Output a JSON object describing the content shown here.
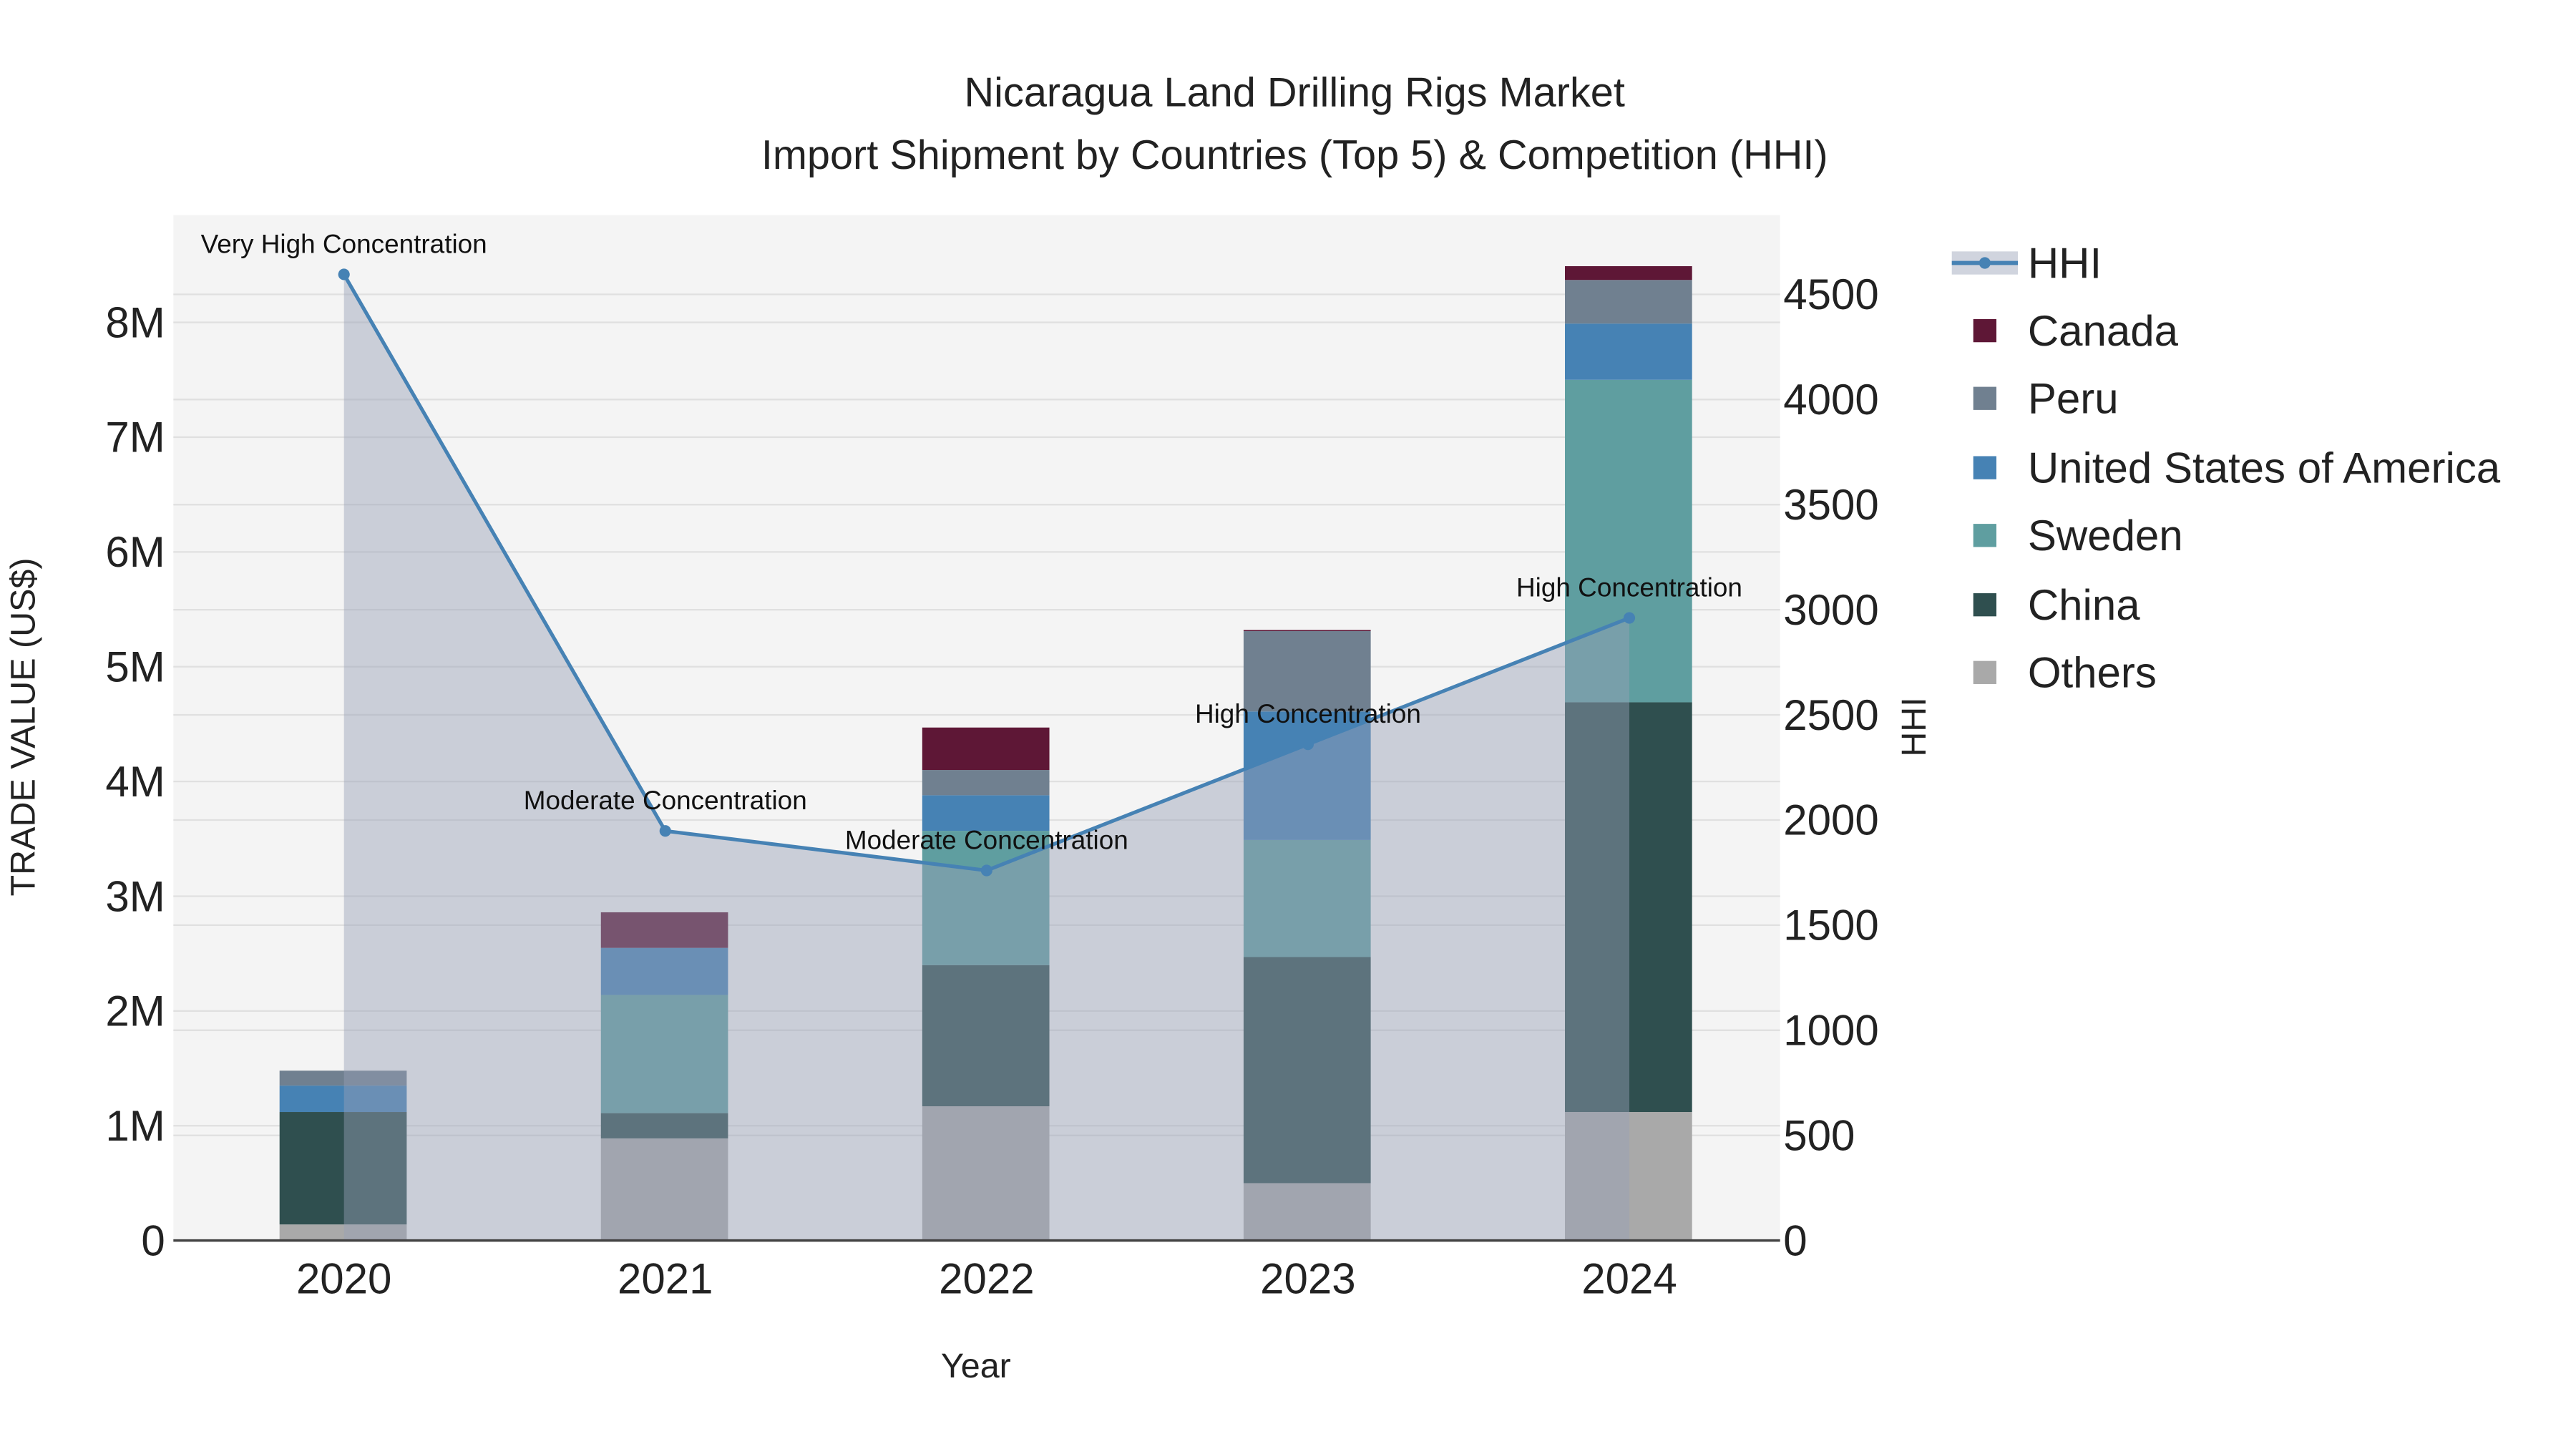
{
  "chart_data": {
    "type": "bar",
    "stacked": true,
    "title": "Nicaragua Land Drilling Rigs Market",
    "subtitle": "Import Shipment by Countries (Top 5) & Competition (HHI)",
    "xlabel": "Year",
    "ylabel": "TRADE VALUE (US$)",
    "y2label": "HHI",
    "categories": [
      "2020",
      "2021",
      "2022",
      "2023",
      "2024"
    ],
    "ylim": [
      0,
      8900000
    ],
    "y_ticks": [
      0,
      1000000,
      2000000,
      3000000,
      4000000,
      5000000,
      6000000,
      7000000,
      8000000
    ],
    "y_tick_labels": [
      "0",
      "1M",
      "2M",
      "3M",
      "4M",
      "5M",
      "6M",
      "7M",
      "8M"
    ],
    "y2lim": [
      0,
      4880
    ],
    "y2_ticks": [
      0,
      500,
      1000,
      1500,
      2000,
      2500,
      3000,
      3500,
      4000,
      4500
    ],
    "y2_tick_labels": [
      "0",
      "500",
      "1000",
      "1500",
      "2000",
      "2500",
      "3000",
      "3500",
      "4000",
      "4500"
    ],
    "grid": true,
    "legend_position": "right",
    "series": [
      {
        "name": "Others",
        "color": "#a9a9a9",
        "values": [
          140000,
          890000,
          1170000,
          500000,
          1120000
        ]
      },
      {
        "name": "China",
        "color": "#2f4f4f",
        "values": [
          980000,
          220000,
          1230000,
          1970000,
          3570000
        ]
      },
      {
        "name": "Sweden",
        "color": "#5f9ea0",
        "values": [
          0,
          1030000,
          1170000,
          1020000,
          2810000
        ]
      },
      {
        "name": "United States of America",
        "color": "#4682b4",
        "values": [
          230000,
          410000,
          310000,
          1120000,
          490000
        ]
      },
      {
        "name": "Peru",
        "color": "#708090",
        "values": [
          130000,
          0,
          220000,
          700000,
          380000
        ]
      },
      {
        "name": "Canada",
        "color": "#5e1736",
        "values": [
          0,
          310000,
          370000,
          10000,
          120000
        ]
      }
    ],
    "line": {
      "name": "HHI",
      "color": "#4682b4",
      "values": [
        4595,
        1948,
        1760,
        2360,
        2961
      ],
      "annotations": [
        "Very High Concentration",
        "Moderate Concentration",
        "Moderate Concentration",
        "High Concentration",
        "High Concentration"
      ]
    },
    "legend_order": [
      "HHI",
      "Canada",
      "Peru",
      "United States of America",
      "Sweden",
      "China",
      "Others"
    ]
  }
}
